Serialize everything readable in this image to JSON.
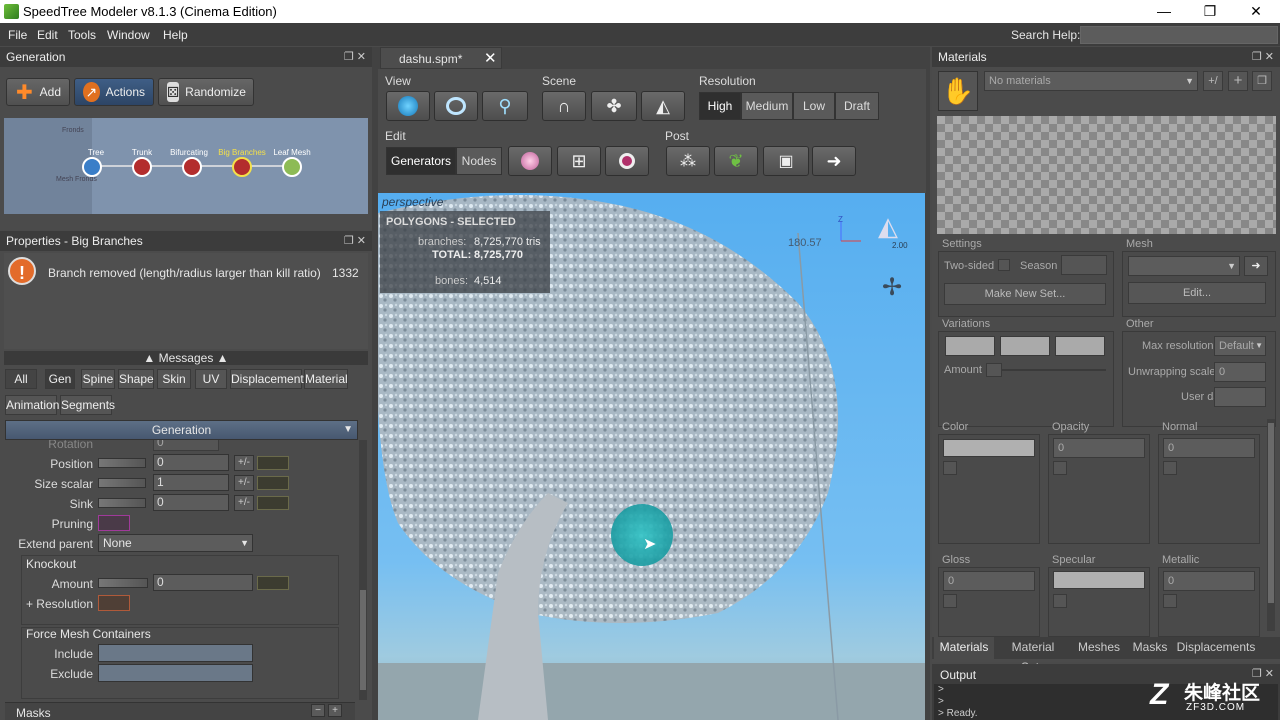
{
  "window": {
    "title": "SpeedTree Modeler v8.1.3 (Cinema Edition)",
    "min": "—",
    "max": "❐",
    "close": "✕"
  },
  "menu": [
    "File",
    "Edit",
    "Tools",
    "Window",
    "Help"
  ],
  "search": {
    "label": "Search Help:",
    "value": ""
  },
  "generation": {
    "title": "Generation",
    "add_label": "Add",
    "actions_label": "Actions",
    "randomize_label": "Randomize",
    "graph_nodes": [
      "Tree",
      "Trunk",
      "Bifurcating",
      "Big Branches",
      "Leaf Mesh"
    ],
    "graph_small": [
      "Fronds",
      "Mesh Fronds"
    ]
  },
  "properties": {
    "title": "Properties - Big Branches",
    "message": "Branch removed (length/radius larger than kill ratio)",
    "message_count": "1332",
    "messages_label": "Messages",
    "tabs_row1": [
      "All",
      "Gen",
      "Spine",
      "Shape",
      "Skin",
      "UV",
      "Displacement",
      "Material"
    ],
    "tabs_row2": [
      "Animation",
      "Segments"
    ],
    "section": "Generation",
    "rows": {
      "rotation_label": "Rotation",
      "rotation_value": "0",
      "position_label": "Position",
      "position_value": "0",
      "size_label": "Size scalar",
      "size_value": "1",
      "sink_label": "Sink",
      "sink_value": "0",
      "pruning_label": "Pruning",
      "extend_label": "Extend parent",
      "extend_value": "None",
      "knockout_label": "Knockout",
      "amount_label": "Amount",
      "amount_value": "0",
      "resolution_label": "+ Resolution",
      "force_label": "Force Mesh Containers",
      "include_label": "Include",
      "exclude_label": "Exclude",
      "pm": "+/-"
    },
    "masks_label": "Masks"
  },
  "document": {
    "tab": "dashu.spm*",
    "view_label": "View",
    "scene_label": "Scene",
    "resolution_label": "Resolution",
    "resolution_options": [
      "High",
      "Medium",
      "Low",
      "Draft"
    ],
    "resolution_selected": "High",
    "edit_label": "Edit",
    "edit_modes": [
      "Generators",
      "Nodes"
    ],
    "post_label": "Post",
    "viewport_name": "perspective",
    "stats_title": "POLYGONS - SELECTED",
    "branches_label": "branches:",
    "branches_value": "8,725,770 tris",
    "total_label": "TOTAL:",
    "total_value": "8,725,770",
    "bones_label": "bones:",
    "bones_value": "4,514",
    "measure": "180.57",
    "zoom": "2.00",
    "axis_z": "Z"
  },
  "materials": {
    "title": "Materials",
    "dropdown": "No materials",
    "settings_label": "Settings",
    "two_sided": "Two-sided",
    "season": "Season",
    "make_new_set": "Make New Set...",
    "mesh_label": "Mesh",
    "edit_btn": "Edit...",
    "variations_label": "Variations",
    "amount_label": "Amount",
    "other_label": "Other",
    "max_res_label": "Max resolution",
    "max_res_value": "Default",
    "unwrap_label": "Unwrapping scale",
    "unwrap_value": "0",
    "user_data_label": "User data",
    "color_label": "Color",
    "opacity_label": "Opacity",
    "opacity_value": "0",
    "normal_label": "Normal",
    "normal_value": "0",
    "gloss_label": "Gloss",
    "gloss_value": "0",
    "specular_label": "Specular",
    "metallic_label": "Metallic",
    "metallic_value": "0",
    "tabs": [
      "Materials",
      "Material Sets",
      "Meshes",
      "Masks",
      "Displacements"
    ]
  },
  "output": {
    "title": "Output",
    "lines": [
      ">",
      ">",
      "> Ready."
    ]
  },
  "watermark": {
    "text": "朱峰社区",
    "sub": "ZF3D.COM"
  }
}
